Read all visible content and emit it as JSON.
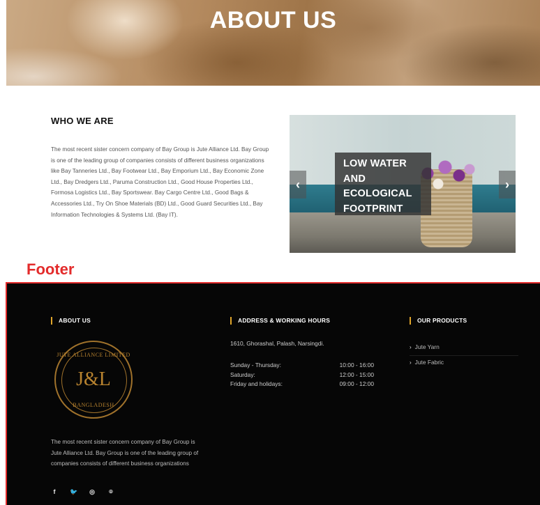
{
  "hero": {
    "title": "ABOUT US"
  },
  "who": {
    "title": "WHO WE ARE",
    "text": "The most recent sister concern company of Bay Group is Jute Alliance Ltd. Bay Group is one of the leading group of companies consists of different business organizations like Bay Tanneries Ltd., Bay Footwear Ltd., Bay Emporium Ltd., Bay Economic Zone Ltd., Bay Dredgers Ltd., Paruma Construction Ltd., Good House Properties Ltd., Formosa Logistics Ltd., Bay Sportswear. Bay Cargo Centre Ltd., Good Bags & Accessories Ltd., Try On Shoe Materials (BD) Ltd., Good Guard Securities Ltd., Bay Information Technologies & Systems Ltd. (Bay IT)."
  },
  "slider": {
    "caption": [
      "LOW WATER",
      "AND",
      "ECOLOGICAL",
      "FOOTPRINT"
    ],
    "prev_icon": "‹",
    "next_icon": "›"
  },
  "annotation": {
    "label": "Footer"
  },
  "footer": {
    "about": {
      "heading": "ABOUT US",
      "logo": {
        "top": "JUTE ALLIANCE LIMITED",
        "mono": "J&L",
        "bottom": "BANGLADESH"
      },
      "text": "The most recent sister concern company of Bay Group is Jute Alliance Ltd. Bay Group is one of the leading group of companies consists of different business organizations",
      "social": [
        {
          "icon": "facebook-icon",
          "glyph": "f"
        },
        {
          "icon": "twitter-icon",
          "glyph": "🐦"
        },
        {
          "icon": "instagram-icon",
          "glyph": "◎"
        },
        {
          "icon": "github-icon",
          "glyph": "⌾"
        }
      ]
    },
    "address": {
      "heading": "ADDRESS & WORKING HOURS",
      "line": "1610, Ghorashal, Palash, Narsingdi.",
      "hours": [
        {
          "day": "Sunday - Thursday:",
          "time": "10:00 - 16:00"
        },
        {
          "day": "Saturday:",
          "time": "12:00 - 15:00"
        },
        {
          "day": "Friday and holidays:",
          "time": "09:00 - 12:00"
        }
      ]
    },
    "products": {
      "heading": "OUR PRODUCTS",
      "items": [
        "Jute Yarn",
        "Jute Fabric"
      ]
    }
  }
}
